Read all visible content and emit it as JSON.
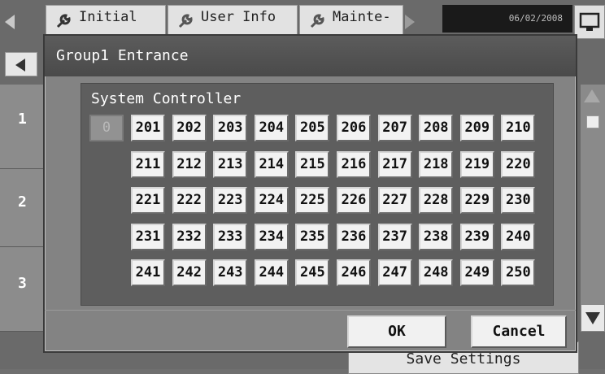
{
  "header": {
    "tabs": [
      {
        "label": "Initial"
      },
      {
        "label": "User Info"
      },
      {
        "label": "Mainte-"
      }
    ],
    "date": "06/02/2008"
  },
  "sidebar": {
    "items": [
      {
        "label": "1"
      },
      {
        "label": "2"
      },
      {
        "label": "3"
      }
    ]
  },
  "background_button": {
    "label": "Save Settings"
  },
  "dialog": {
    "title": "Group1 Entrance",
    "panel_title": "System Controller",
    "disabled_cell": "0",
    "rows": [
      [
        "201",
        "202",
        "203",
        "204",
        "205",
        "206",
        "207",
        "208",
        "209",
        "210"
      ],
      [
        "211",
        "212",
        "213",
        "214",
        "215",
        "216",
        "217",
        "218",
        "219",
        "220"
      ],
      [
        "221",
        "222",
        "223",
        "224",
        "225",
        "226",
        "227",
        "228",
        "229",
        "230"
      ],
      [
        "231",
        "232",
        "233",
        "234",
        "235",
        "236",
        "237",
        "238",
        "239",
        "240"
      ],
      [
        "241",
        "242",
        "243",
        "244",
        "245",
        "246",
        "247",
        "248",
        "249",
        "250"
      ]
    ],
    "ok_label": "OK",
    "cancel_label": "Cancel"
  },
  "colors": {
    "dialog_bg": "#838383",
    "title_bar": "#4f4f4f",
    "panel_bg": "#5e5e5e",
    "cell_bg": "#f2f2f2",
    "date_bg": "#1a1a1a"
  }
}
